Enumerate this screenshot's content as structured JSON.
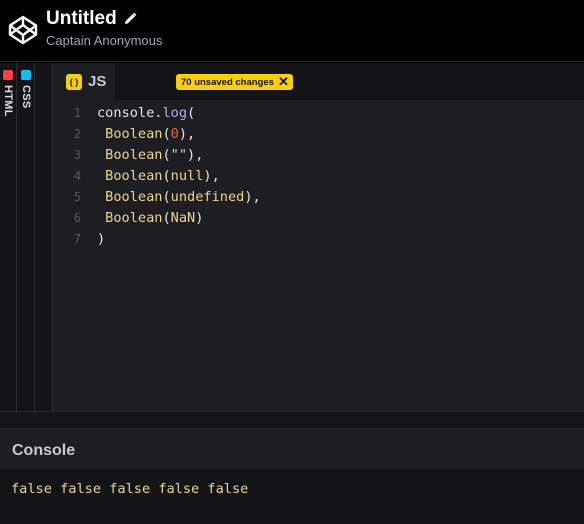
{
  "header": {
    "title": "Untitled",
    "author": "Captain Anonymous"
  },
  "side_tabs": [
    {
      "label": "HTML",
      "color": "#ff3c41"
    },
    {
      "label": "CSS",
      "color": "#0ebeff"
    }
  ],
  "editor": {
    "tab_label": "JS",
    "badge_glyph": "( )",
    "unsaved_label": "70 unsaved changes",
    "unsaved_close": "✕",
    "line_numbers": [
      "1",
      "2",
      "3",
      "4",
      "5",
      "6",
      "7"
    ],
    "lines": [
      [
        {
          "t": "console.",
          "c": "plain"
        },
        {
          "t": "log",
          "c": "prop"
        },
        {
          "t": "(",
          "c": "plain"
        }
      ],
      [
        {
          "t": " Boolean",
          "c": "bool"
        },
        {
          "t": "(",
          "c": "plain"
        },
        {
          "t": "0",
          "c": "num"
        },
        {
          "t": "),",
          "c": "plain"
        }
      ],
      [
        {
          "t": " Boolean",
          "c": "bool"
        },
        {
          "t": "(",
          "c": "plain"
        },
        {
          "t": "\"\"",
          "c": "str"
        },
        {
          "t": "),",
          "c": "plain"
        }
      ],
      [
        {
          "t": " Boolean",
          "c": "bool"
        },
        {
          "t": "(",
          "c": "plain"
        },
        {
          "t": "null",
          "c": "bool"
        },
        {
          "t": "),",
          "c": "plain"
        }
      ],
      [
        {
          "t": " Boolean",
          "c": "bool"
        },
        {
          "t": "(",
          "c": "plain"
        },
        {
          "t": "undefined",
          "c": "bool"
        },
        {
          "t": "),",
          "c": "plain"
        }
      ],
      [
        {
          "t": " Boolean",
          "c": "bool"
        },
        {
          "t": "(",
          "c": "plain"
        },
        {
          "t": "NaN",
          "c": "bool"
        },
        {
          "t": ")",
          "c": "plain"
        }
      ],
      [
        {
          "t": ")",
          "c": "plain"
        }
      ]
    ]
  },
  "console": {
    "title": "Console",
    "output": "false false false false false"
  },
  "colors": {
    "accent_yellow": "#fcd000",
    "editor_bg": "#1d1e22"
  }
}
